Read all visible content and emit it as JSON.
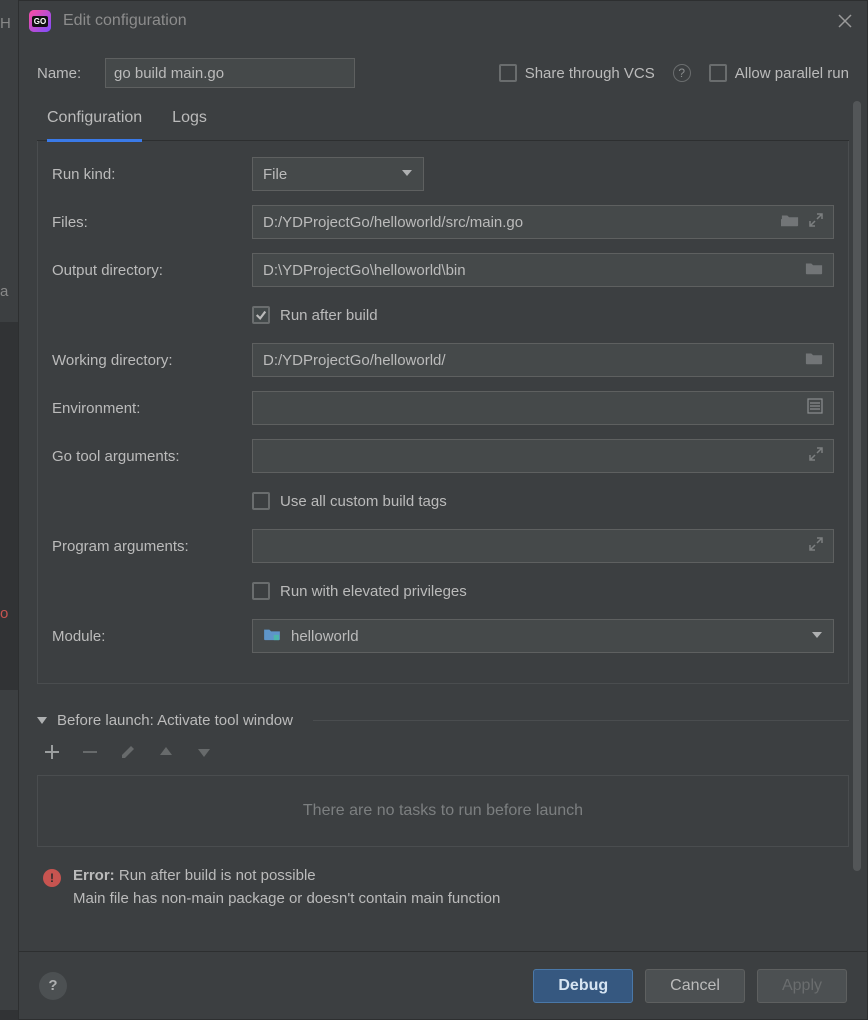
{
  "titlebar": {
    "title": "Edit configuration"
  },
  "name_row": {
    "label": "Name:",
    "value": "go build main.go",
    "share_label": "Share through VCS",
    "allow_parallel_label": "Allow parallel run"
  },
  "tabs": {
    "configuration": "Configuration",
    "logs": "Logs"
  },
  "form": {
    "run_kind_label": "Run kind:",
    "run_kind_value": "File",
    "files_label": "Files:",
    "files_value": "D:/YDProjectGo/helloworld/src/main.go",
    "output_label": "Output directory:",
    "output_value": "D:\\YDProjectGo\\helloworld\\bin",
    "run_after_build_label": "Run after build",
    "working_dir_label": "Working directory:",
    "working_dir_value": "D:/YDProjectGo/helloworld/",
    "environment_label": "Environment:",
    "environment_value": "",
    "go_tool_args_label": "Go tool arguments:",
    "go_tool_args_value": "",
    "use_all_tags_label": "Use all custom build tags",
    "program_args_label": "Program arguments:",
    "program_args_value": "",
    "run_elevated_label": "Run with elevated privileges",
    "module_label": "Module:",
    "module_value": "helloworld"
  },
  "before_launch": {
    "header": "Before launch: Activate tool window",
    "empty_text": "There are no tasks to run before launch"
  },
  "error": {
    "prefix": "Error:",
    "line1": " Run after build is not possible",
    "line2": "Main file has non-main package or doesn't contain main function"
  },
  "footer": {
    "debug": "Debug",
    "cancel": "Cancel",
    "apply": "Apply"
  }
}
